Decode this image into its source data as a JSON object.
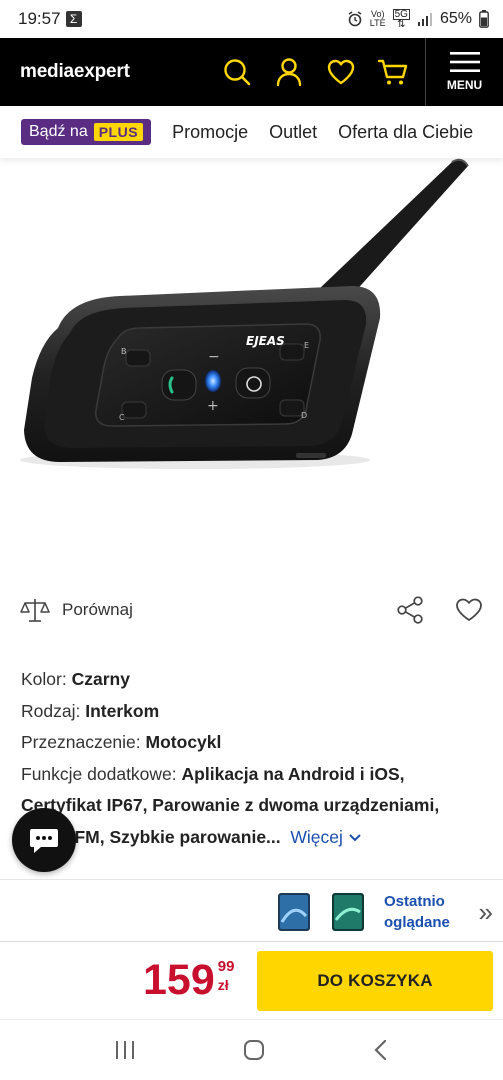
{
  "status": {
    "time": "19:57",
    "sigma": "Σ",
    "net_top": "Vo)",
    "net_bottom": "LTE",
    "gen_top": "5G",
    "battery": "65%"
  },
  "header": {
    "logo_a": "media",
    "logo_b": "expert",
    "menu_label": "MENU",
    "icons": [
      "search-icon",
      "user-icon",
      "heart-icon",
      "cart-icon",
      "menu-icon"
    ]
  },
  "nav": {
    "plus_prefix": "Bądź na",
    "plus_badge": "PLUS",
    "items": [
      "Promocje",
      "Outlet",
      "Oferta dla Ciebie"
    ]
  },
  "product": {
    "brand_text": "EJEAS"
  },
  "actions": {
    "compare_label": "Porównaj"
  },
  "specs": {
    "color_label": "Kolor:",
    "color_value": "Czarny",
    "type_label": "Rodzaj:",
    "type_value": "Interkom",
    "purpose_label": "Przeznaczenie:",
    "purpose_value": "Motocykl",
    "extra_label": "Funkcje dodatkowe:",
    "extra_value_1": "Aplikacja na Android i iOS,",
    "extra_value_2": "Certyfikat IP67, Parowanie z dwoma urządzeniami,",
    "extra_value_3": "Radio FM, Szybkie parowanie...",
    "more_label": "Więcej"
  },
  "recent": {
    "label_line1": "Ostatnio",
    "label_line2": "oglądane"
  },
  "buy": {
    "price_int": "159",
    "price_dec": "99",
    "currency": "zł",
    "cart_label": "DO KOSZYKA"
  },
  "colors": {
    "brand_yellow": "#ffd600",
    "price_red": "#c8102e",
    "link_blue": "#1b4fae",
    "plus_purple": "#5a2d82"
  }
}
